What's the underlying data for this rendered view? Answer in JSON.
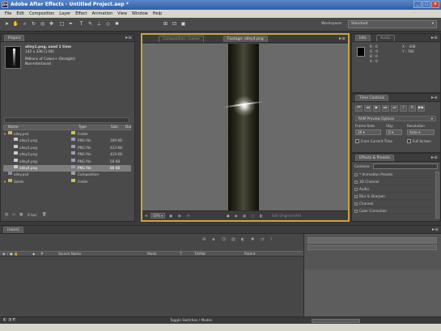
{
  "app": {
    "title": "Adobe After Effects - Untitled Project.aep *"
  },
  "menu": [
    "File",
    "Edit",
    "Composition",
    "Layer",
    "Effect",
    "Animation",
    "View",
    "Window",
    "Help"
  ],
  "toolbar": {
    "workspace_label": "Workspace:",
    "workspace_value": "Standard"
  },
  "project": {
    "tab": "Project",
    "footage_name": "alley1.png, used 1 time",
    "footage_dims": "142 x 336 (1.00)",
    "footage_colors": "Millions of Colors+ (Straight)",
    "footage_interlace": "Non-Interlaced",
    "columns": {
      "name": "Name",
      "type": "Type",
      "size": "Size",
      "dur": "Dur"
    },
    "items": [
      {
        "name": "alley.psd",
        "type": "Folder",
        "size": "",
        "indent": 0,
        "icon": "folder-icon",
        "swatch": "#d2c24a",
        "selected": false
      },
      {
        "name": "alley1.png",
        "type": "PNG file",
        "size": "189 KB",
        "indent": 1,
        "icon": "image-file-icon",
        "swatch": "#9a9ab8",
        "selected": false
      },
      {
        "name": "alley2.png",
        "type": "PNG file",
        "size": "423 KB",
        "indent": 1,
        "icon": "image-file-icon",
        "swatch": "#9a9ab8",
        "selected": false
      },
      {
        "name": "alley3.png",
        "type": "PNG file",
        "size": "419 KB",
        "indent": 1,
        "icon": "image-file-icon",
        "swatch": "#9a9ab8",
        "selected": false
      },
      {
        "name": "alley4.png",
        "type": "PNG file",
        "size": "58 KB",
        "indent": 1,
        "icon": "image-file-icon",
        "swatch": "#9a9ab8",
        "selected": false
      },
      {
        "name": "alley4.png",
        "type": "PNG file",
        "size": "86 KB",
        "indent": 1,
        "icon": "image-file-icon",
        "swatch": "#9a9ab8",
        "selected": true
      },
      {
        "name": "alley.psd",
        "type": "Composition",
        "size": "",
        "indent": 0,
        "icon": "composition-icon",
        "swatch": "#a0a0a0",
        "selected": false
      },
      {
        "name": "Solids",
        "type": "Folder",
        "size": "",
        "indent": 0,
        "icon": "folder-icon",
        "swatch": "#d2c24a",
        "selected": false
      }
    ],
    "footer_bpc": "8 bpc"
  },
  "viewer": {
    "tab_comp": "Composition: (none)",
    "tab_footage": "Footage: alley4.png",
    "zoom": "50%",
    "resolution": "Full",
    "footage_label": "Edit Original (Alt)"
  },
  "info": {
    "tab_info": "Info",
    "tab_audio": "Audio",
    "r_label": "R :",
    "g_label": "G :",
    "b_label": "B :",
    "a_label": "A :",
    "r_val": "0",
    "g_val": "0",
    "b_val": "0",
    "a_val": "0",
    "x": "X : -308",
    "y": "Y : 780"
  },
  "time_controls": {
    "tab": "Time Controls",
    "ram_preview": "RAM Preview Options",
    "frame_rate_label": "Frame Rate",
    "skip_label": "Skip",
    "resolution_label": "Resolution",
    "frame_rate_value": "30",
    "skip_value": "0",
    "resolution_value": "Auto",
    "from_current": "From Current Time",
    "full_screen": "Full Screen"
  },
  "effects": {
    "tab": "Effects & Presets",
    "contains_label": "Contains:",
    "items": [
      "* Animation Presets",
      "3D Channel",
      "Audio",
      "Blur & Sharpen",
      "Channel",
      "Color Correction"
    ]
  },
  "timeline": {
    "tab": "(none)",
    "columns": {
      "source": "Source Name",
      "mode": "Mode",
      "t": "T",
      "trkmat": "TrkMat",
      "parent": "Parent"
    },
    "footer": "Toggle Switches / Modes"
  }
}
